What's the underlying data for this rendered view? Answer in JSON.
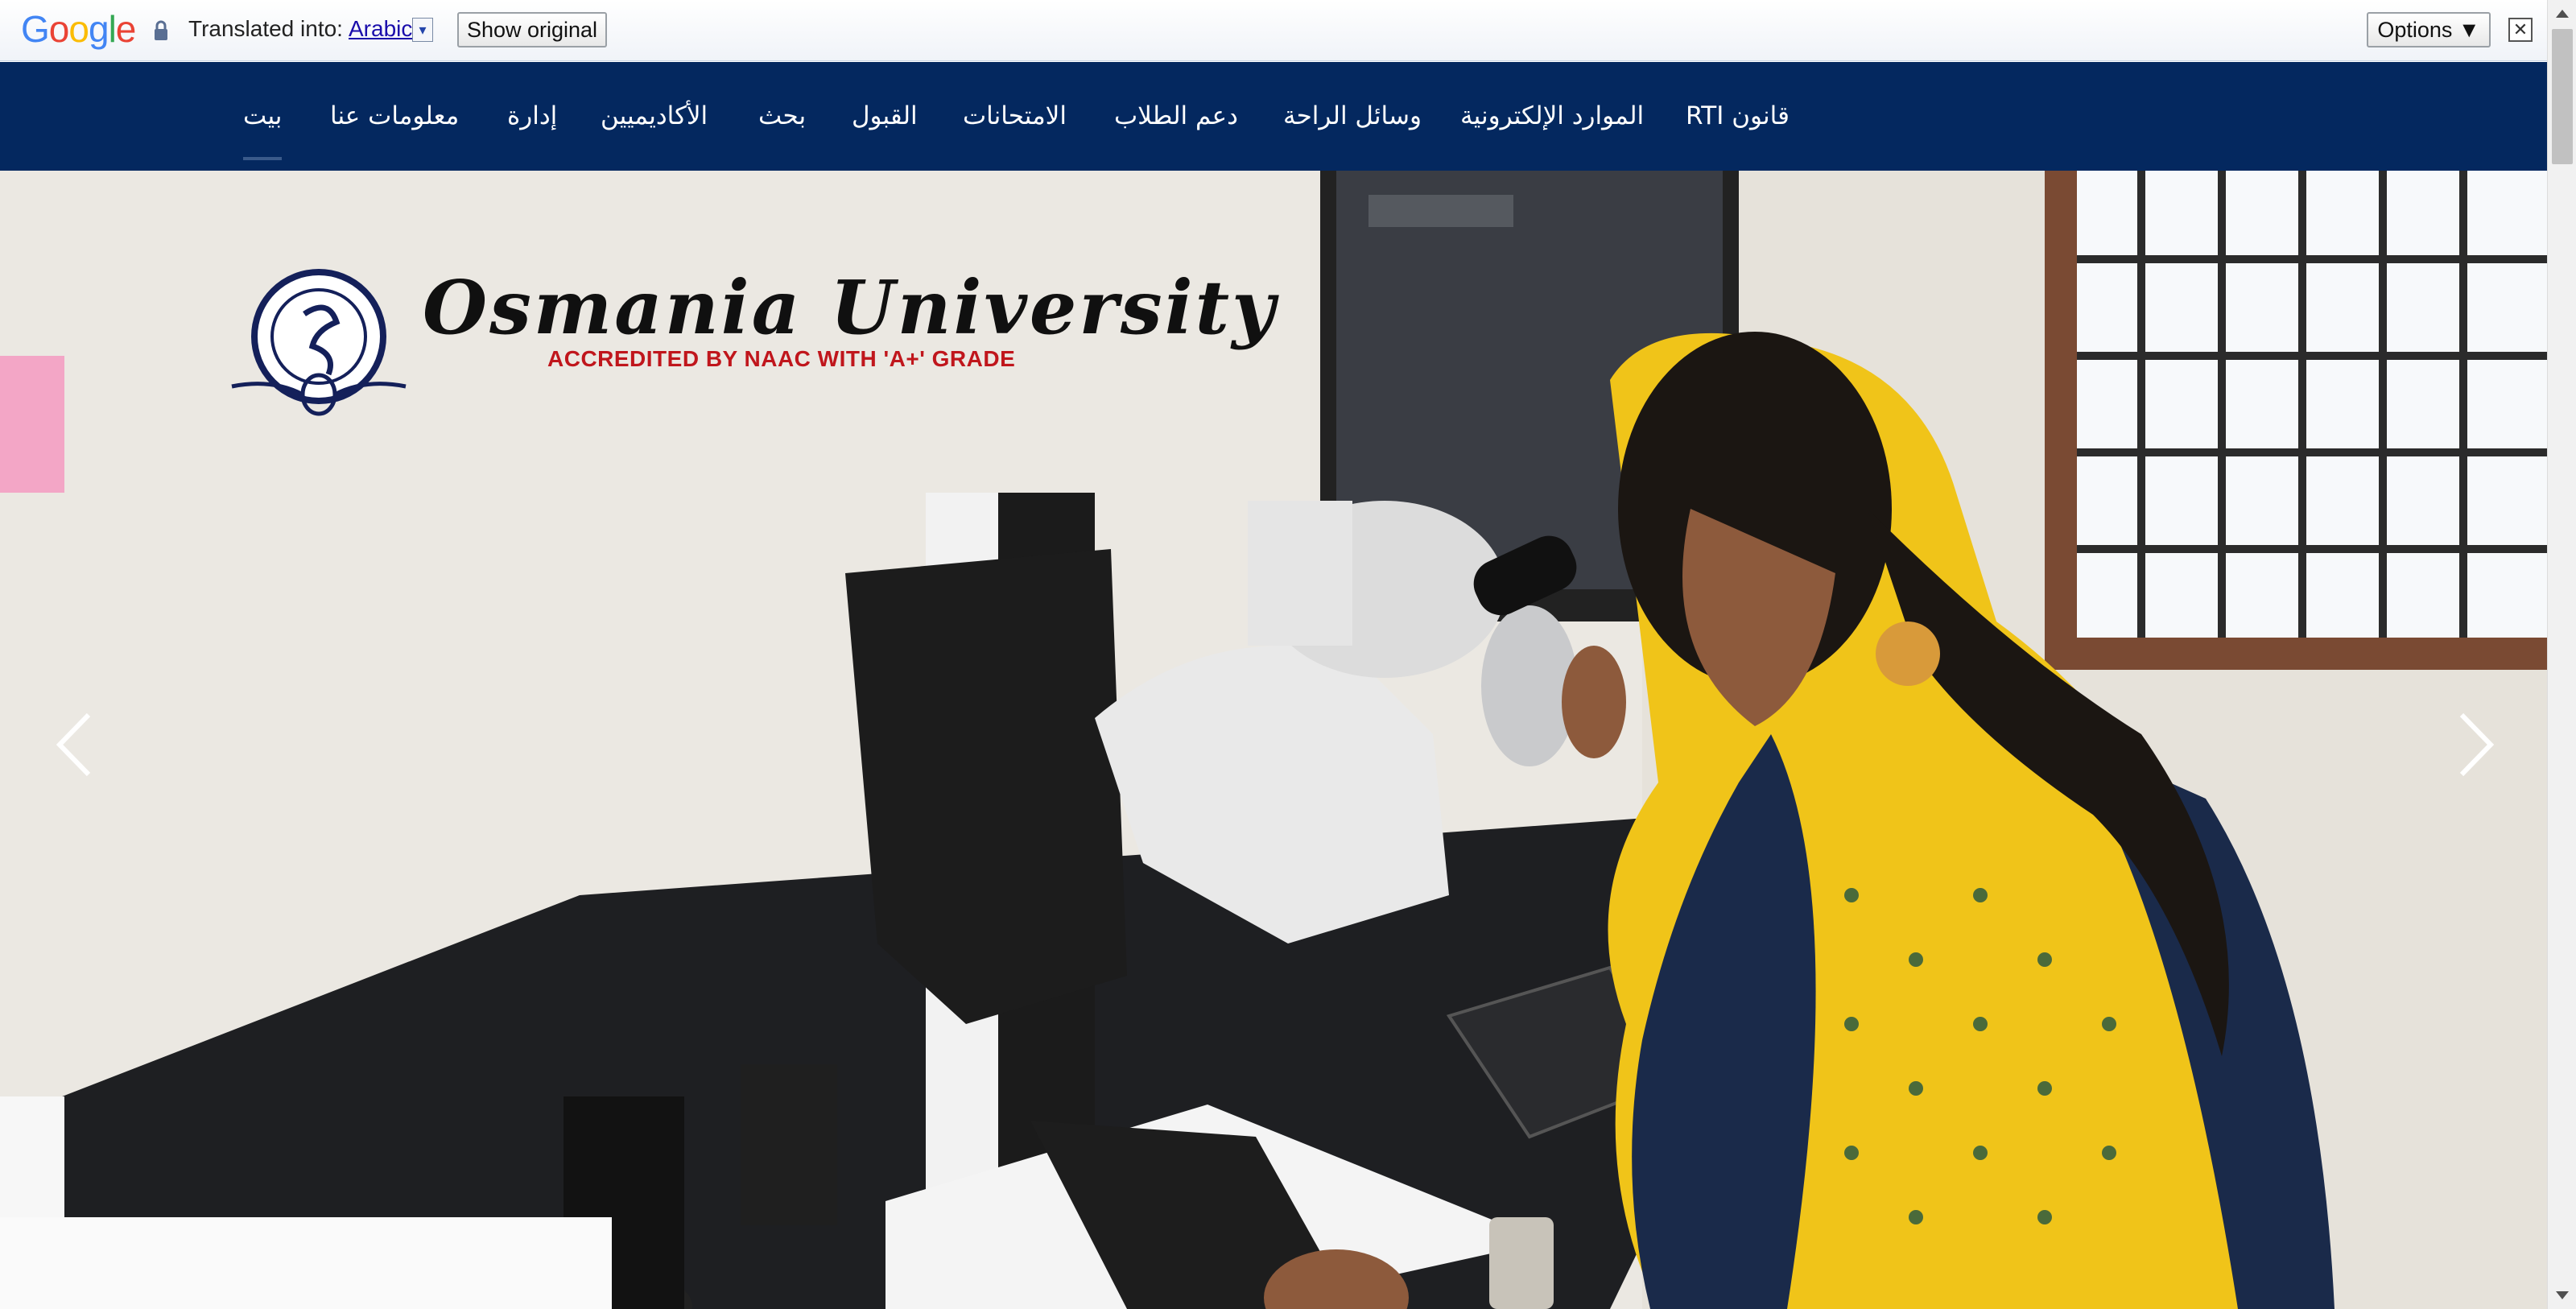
{
  "translate_bar": {
    "logo_text": "Google",
    "lock_icon": "lock-icon",
    "translated_into_label": "Translated into:",
    "language": "Arabic",
    "show_original_label": "Show original",
    "options_label": "Options ▼",
    "close_glyph": "✕"
  },
  "nav": {
    "background": "#04285f",
    "items": [
      {
        "label": "بيت",
        "active": true
      },
      {
        "label": "معلومات عنا"
      },
      {
        "label": "إدارة"
      },
      {
        "label": "الأكاديميين"
      },
      {
        "label": "بحث"
      },
      {
        "label": "القبول"
      },
      {
        "label": "الامتحانات"
      },
      {
        "label": "دعم الطلاب"
      },
      {
        "label": "وسائل الراحة"
      },
      {
        "label": "الموارد الإلكترونية"
      },
      {
        "label": "قانون RTI"
      }
    ]
  },
  "hero": {
    "university_name": "Osmania University",
    "accreditation": "ACCREDITED BY NAAC WITH 'A+' GRADE",
    "accent_red": "#c0161c",
    "seal_icon": "university-seal-icon",
    "prev_icon": "chevron-left-icon",
    "next_icon": "chevron-right-icon"
  }
}
